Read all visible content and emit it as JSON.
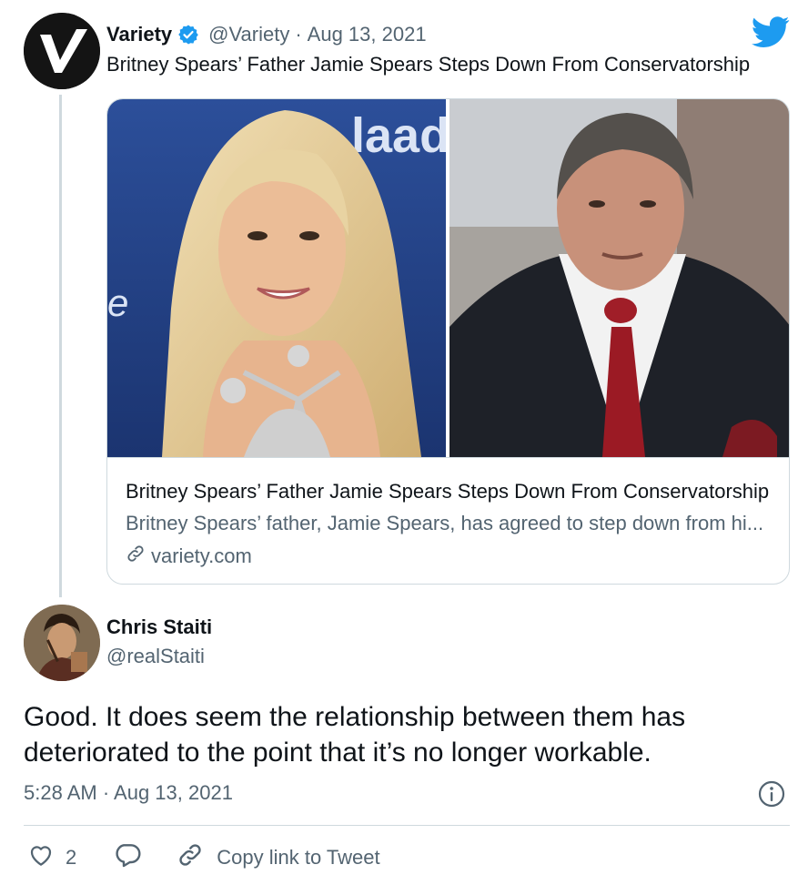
{
  "quoted_tweet": {
    "author_name": "Variety",
    "handle": "@Variety",
    "separator": "·",
    "date": "Aug 13, 2021",
    "text": "Britney Spears’ Father Jamie Spears Steps Down From Conservatorship",
    "verified_icon": "verified-badge-icon",
    "platform_icon": "twitter-bird-icon",
    "avatar_logo": "variety-v-logo"
  },
  "link_card": {
    "title": "Britney Spears’ Father Jamie Spears Steps Down From Conservatorship",
    "description": "Britney Spears’ father, Jamie Spears, has agreed to step down from hi...",
    "domain": "variety.com",
    "domain_icon": "link-icon"
  },
  "tweet": {
    "author_name": "Chris Staiti",
    "handle": "@realStaiti",
    "text": "Good. It does seem the relationship between them has deteriorated to the point that it’s no longer workable.",
    "timestamp": "5:28 AM · Aug 13, 2021"
  },
  "actions": {
    "like_count": "2",
    "copy_link_label": "Copy link to Tweet"
  },
  "colors": {
    "text_primary": "#0f1419",
    "text_secondary": "#536471",
    "border": "#cfd9de",
    "twitter_blue": "#1d9bf0"
  }
}
